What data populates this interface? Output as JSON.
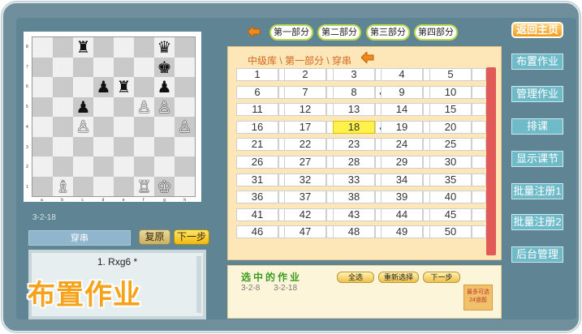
{
  "board": {
    "ranks": [
      "8",
      "7",
      "6",
      "5",
      "4",
      "3",
      "2",
      "1"
    ],
    "files": [
      "a",
      "b",
      "c",
      "d",
      "e",
      "f",
      "g",
      "h"
    ],
    "squares": [
      [
        "",
        "",
        {
          "g": "♜",
          "c": "b"
        },
        "",
        "",
        "",
        {
          "g": "♛",
          "c": "b"
        },
        ""
      ],
      [
        "",
        "",
        "",
        "",
        "",
        "",
        {
          "g": "♚",
          "c": "b"
        },
        ""
      ],
      [
        "",
        "",
        "",
        {
          "g": "♟",
          "c": "b"
        },
        {
          "g": "♜",
          "c": "b"
        },
        "",
        {
          "g": "♟",
          "c": "b"
        },
        ""
      ],
      [
        "",
        "",
        {
          "g": "♟",
          "c": "b"
        },
        "",
        "",
        {
          "g": "♙",
          "c": "w"
        },
        {
          "g": "♙",
          "c": "w"
        },
        ""
      ],
      [
        "",
        "",
        {
          "g": "♙",
          "c": "w"
        },
        "",
        "",
        "",
        "",
        {
          "g": "♙",
          "c": "w"
        }
      ],
      [
        "",
        "",
        "",
        "",
        "",
        "",
        "",
        ""
      ],
      [
        "",
        "",
        "",
        "",
        "",
        "",
        "",
        ""
      ],
      [
        "",
        {
          "g": "♗",
          "c": "w"
        },
        "",
        "",
        "",
        {
          "g": "♖",
          "c": "w"
        },
        {
          "g": "♔",
          "c": "w"
        },
        ""
      ]
    ],
    "position_code": "3-2-18"
  },
  "left": {
    "category": "穿串",
    "reset_label": "复原",
    "next_label": "下一步",
    "move": "1. Rxg6 *",
    "big_title": "布置作业"
  },
  "parts": [
    "第一部分",
    "第二部分",
    "第三部分",
    "第四部分"
  ],
  "main": {
    "crumb": "中级库 \\ 第一部分 \\ 穿串",
    "numbers": [
      1,
      2,
      3,
      4,
      5,
      6,
      7,
      8,
      9,
      10,
      11,
      12,
      13,
      14,
      15,
      16,
      17,
      18,
      19,
      20,
      21,
      22,
      23,
      24,
      25,
      26,
      27,
      28,
      29,
      30,
      31,
      32,
      33,
      34,
      35,
      36,
      37,
      38,
      39,
      40,
      41,
      42,
      43,
      44,
      45,
      46,
      47,
      48,
      49,
      50
    ],
    "checked": [
      8,
      18
    ],
    "highlighted": 18,
    "check_mark": "✓"
  },
  "selected": {
    "title": "选中的作业",
    "items": [
      "3-2-8",
      "3-2-18"
    ],
    "select_all": "全选",
    "reselect": "重新选择",
    "next": "下一步",
    "limit_note": "最多可选24道题"
  },
  "sidebar": {
    "home": "返回主页",
    "items": [
      "布置作业",
      "管理作业",
      "排课",
      "显示课节",
      "批量注册1",
      "批量注册2",
      "后台管理"
    ]
  },
  "colors": {
    "accent_orange": "#f29a1a",
    "selected_yellow": "#fff24a",
    "tab_border_green": "#b9d84c",
    "sidebar_teal": "#6ebac8",
    "scroll_red": "#e15a57"
  }
}
